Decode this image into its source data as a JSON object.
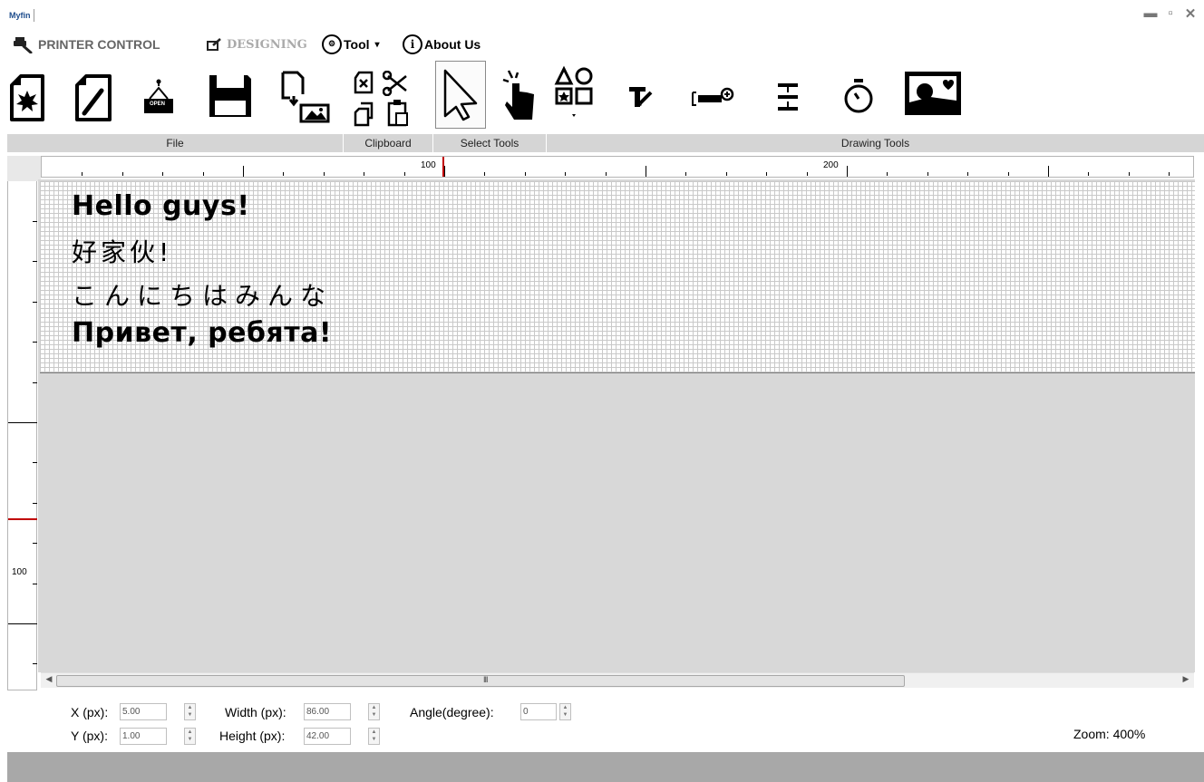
{
  "app": {
    "logo": "Myfin"
  },
  "window_controls": {
    "minimize": "▬",
    "maximize": "▫",
    "close": "✕"
  },
  "menu": {
    "printer_control": "PRINTER CONTROL",
    "designing": "DESIGNING",
    "tool": "Tool",
    "tool_arrow": "▾",
    "about_icon": "i",
    "about": "About Us"
  },
  "ribbon": {
    "open_label": "OPEN",
    "groups": {
      "file": "File",
      "clipboard": "Clipboard",
      "select_tools": "Select Tools",
      "drawing_tools": "Drawing Tools"
    }
  },
  "rulers": {
    "h_labels": [
      "100",
      "200"
    ],
    "v_labels": [
      "100"
    ],
    "marker_color": "#c00000"
  },
  "canvas": {
    "lines": [
      "Hello guys!",
      "好家伙!",
      "こんにちはみんな",
      "Привет, ребята!"
    ]
  },
  "scrollbar": {
    "grip": "III",
    "left_arrow": "◀",
    "right_arrow": "▶"
  },
  "properties": {
    "x_label": "X (px):",
    "x_value": "5.00",
    "y_label": "Y (px):",
    "y_value": "1.00",
    "width_label": "Width (px):",
    "width_value": "86.00",
    "height_label": "Height (px):",
    "height_value": "42.00",
    "angle_label": "Angle(degree):",
    "angle_value": "0",
    "zoom": "Zoom: 400%"
  },
  "icons": {
    "printer": "printer-icon",
    "designing": "designing-icon",
    "tool": "gear-network-icon",
    "about": "info-icon",
    "new_file": "new-file-icon",
    "edit_file": "edit-file-icon",
    "open": "open-sign-icon",
    "save": "floppy-disk-icon",
    "import": "import-image-icon",
    "delete": "delete-icon",
    "cut": "scissors-icon",
    "copy": "copy-icon",
    "paste": "paste-icon",
    "select": "arrow-cursor-icon",
    "hand": "hand-pointer-icon",
    "shapes": "shapes-icon",
    "text": "text-tool-icon",
    "barcode": "barcode-add-icon",
    "align": "align-icon",
    "timer": "stopwatch-icon",
    "image": "picture-icon"
  }
}
